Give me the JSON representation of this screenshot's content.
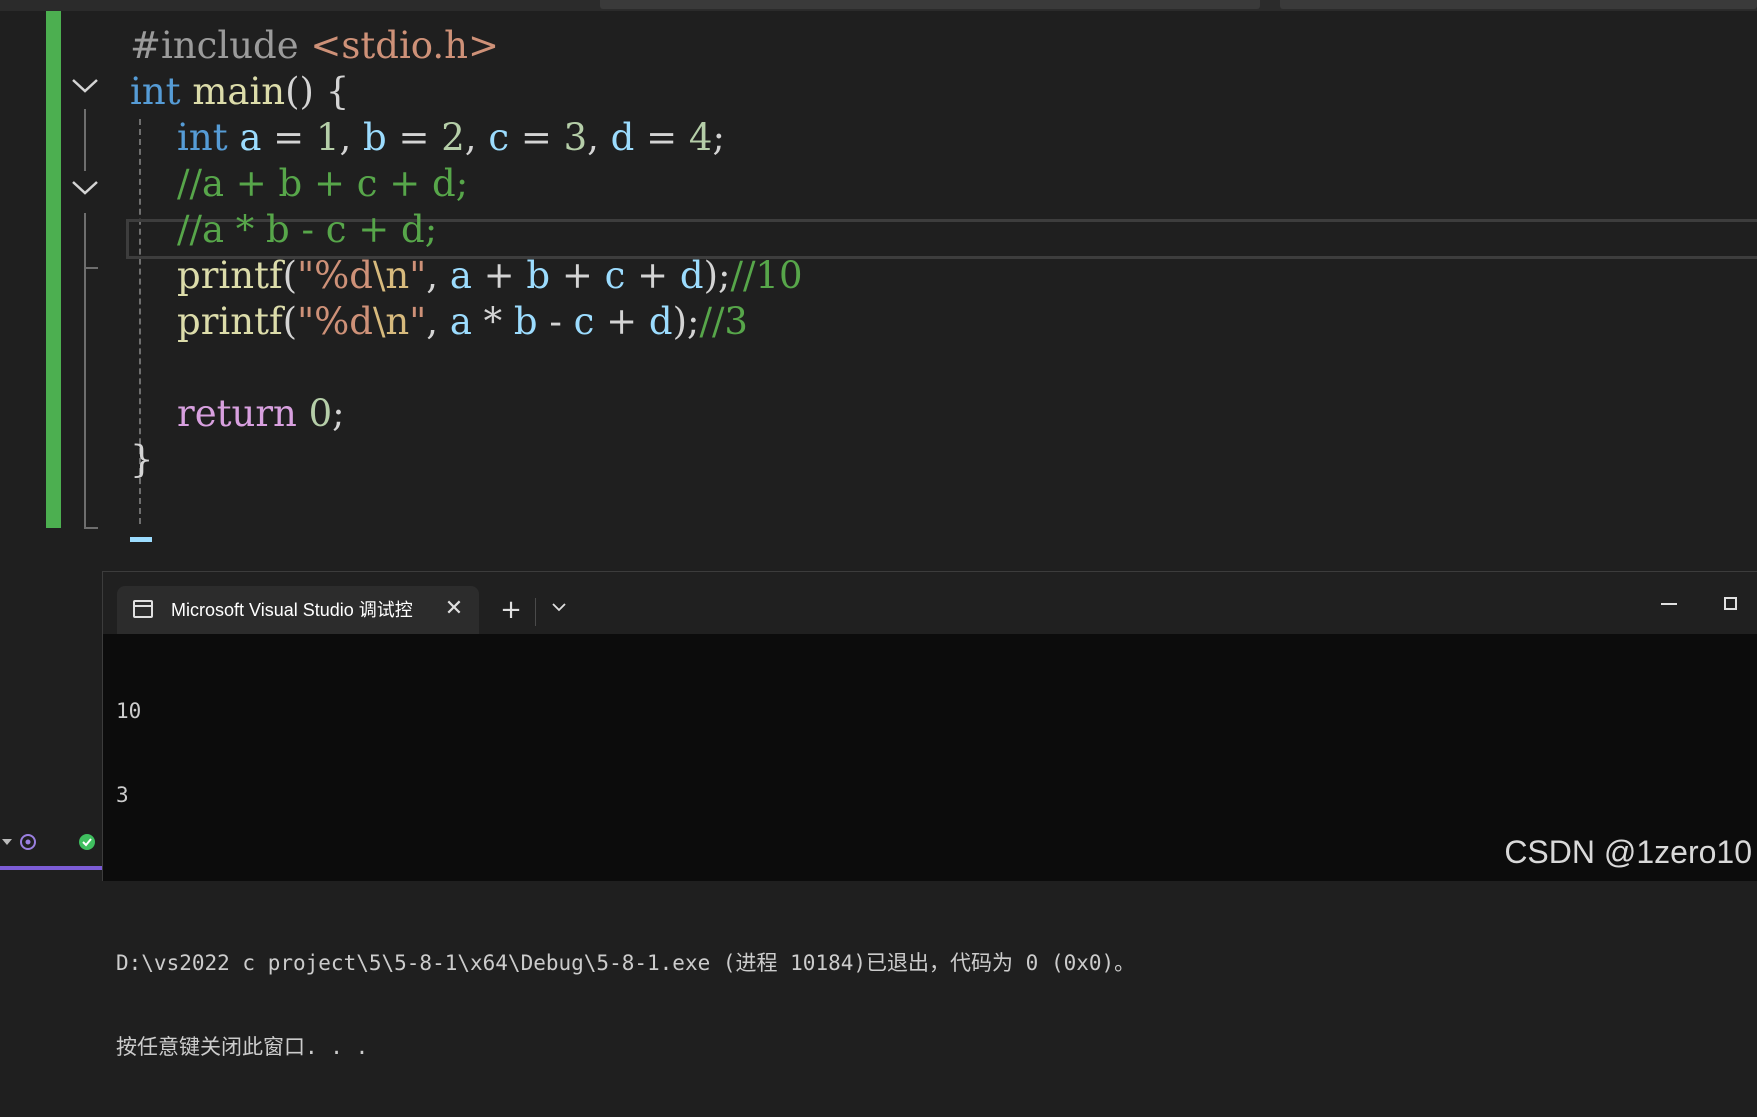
{
  "editor": {
    "lines": [
      [
        {
          "t": "#include ",
          "c": "k-pre"
        },
        {
          "t": "<stdio.h>",
          "c": "k-inc"
        }
      ],
      [
        {
          "t": "int",
          "c": "k-type"
        },
        {
          "t": " ",
          "c": "k-op"
        },
        {
          "t": "main",
          "c": "k-fn"
        },
        {
          "t": "() {",
          "c": "k-op"
        }
      ],
      [
        {
          "t": "    ",
          "c": "k-op"
        },
        {
          "t": "int",
          "c": "k-type"
        },
        {
          "t": " ",
          "c": "k-op"
        },
        {
          "t": "a",
          "c": "k-var"
        },
        {
          "t": " = ",
          "c": "k-op"
        },
        {
          "t": "1",
          "c": "k-num"
        },
        {
          "t": ", ",
          "c": "k-op"
        },
        {
          "t": "b",
          "c": "k-var"
        },
        {
          "t": " = ",
          "c": "k-op"
        },
        {
          "t": "2",
          "c": "k-num"
        },
        {
          "t": ", ",
          "c": "k-op"
        },
        {
          "t": "c",
          "c": "k-var"
        },
        {
          "t": " = ",
          "c": "k-op"
        },
        {
          "t": "3",
          "c": "k-num"
        },
        {
          "t": ", ",
          "c": "k-op"
        },
        {
          "t": "d",
          "c": "k-var"
        },
        {
          "t": " = ",
          "c": "k-op"
        },
        {
          "t": "4",
          "c": "k-num"
        },
        {
          "t": ";",
          "c": "k-op"
        }
      ],
      [
        {
          "t": "    ",
          "c": "k-op"
        },
        {
          "t": "//a + b + c + d;",
          "c": "k-cmt"
        }
      ],
      [
        {
          "t": "    ",
          "c": "k-op"
        },
        {
          "t": "//a * b - c + d;",
          "c": "k-cmt"
        }
      ],
      [
        {
          "t": "    ",
          "c": "k-op"
        },
        {
          "t": "printf",
          "c": "k-fn"
        },
        {
          "t": "(",
          "c": "k-op"
        },
        {
          "t": "\"%d",
          "c": "k-str"
        },
        {
          "t": "\\n",
          "c": "k-esc"
        },
        {
          "t": "\"",
          "c": "k-str"
        },
        {
          "t": ", ",
          "c": "k-op"
        },
        {
          "t": "a",
          "c": "k-var"
        },
        {
          "t": " + ",
          "c": "k-op"
        },
        {
          "t": "b",
          "c": "k-var"
        },
        {
          "t": " + ",
          "c": "k-op"
        },
        {
          "t": "c",
          "c": "k-var"
        },
        {
          "t": " + ",
          "c": "k-op"
        },
        {
          "t": "d",
          "c": "k-var"
        },
        {
          "t": ");",
          "c": "k-op"
        },
        {
          "t": "//10",
          "c": "k-cmt"
        }
      ],
      [
        {
          "t": "    ",
          "c": "k-op"
        },
        {
          "t": "printf",
          "c": "k-fn"
        },
        {
          "t": "(",
          "c": "k-op"
        },
        {
          "t": "\"%d",
          "c": "k-str"
        },
        {
          "t": "\\n",
          "c": "k-esc"
        },
        {
          "t": "\"",
          "c": "k-str"
        },
        {
          "t": ", ",
          "c": "k-op"
        },
        {
          "t": "a",
          "c": "k-var"
        },
        {
          "t": " * ",
          "c": "k-op"
        },
        {
          "t": "b",
          "c": "k-var"
        },
        {
          "t": " - ",
          "c": "k-op"
        },
        {
          "t": "c",
          "c": "k-var"
        },
        {
          "t": " + ",
          "c": "k-op"
        },
        {
          "t": "d",
          "c": "k-var"
        },
        {
          "t": ");",
          "c": "k-op"
        },
        {
          "t": "//3",
          "c": "k-cmt"
        }
      ],
      [
        {
          "t": "",
          "c": "k-op"
        }
      ],
      [
        {
          "t": "    ",
          "c": "k-op"
        },
        {
          "t": "return",
          "c": "k-ret"
        },
        {
          "t": " ",
          "c": "k-op"
        },
        {
          "t": "0",
          "c": "k-num"
        },
        {
          "t": ";",
          "c": "k-op"
        }
      ],
      [
        {
          "t": "}",
          "c": "k-op"
        }
      ]
    ]
  },
  "console": {
    "tab_title": "Microsoft Visual Studio 调试控",
    "close_glyph": "✕",
    "new_tab_glyph": "+",
    "output_lines": [
      "10",
      "3",
      "",
      "D:\\vs2022 c project\\5\\5-8-1\\x64\\Debug\\5-8-1.exe (进程 10184)已退出，代码为 0 (0x0)。",
      "按任意键关闭此窗口. . ."
    ]
  },
  "watermark": "CSDN @1zero10",
  "icons": [
    "chevron-down-icon",
    "terminal-icon",
    "close-icon",
    "plus-icon",
    "minimize-icon",
    "maximize-icon"
  ]
}
